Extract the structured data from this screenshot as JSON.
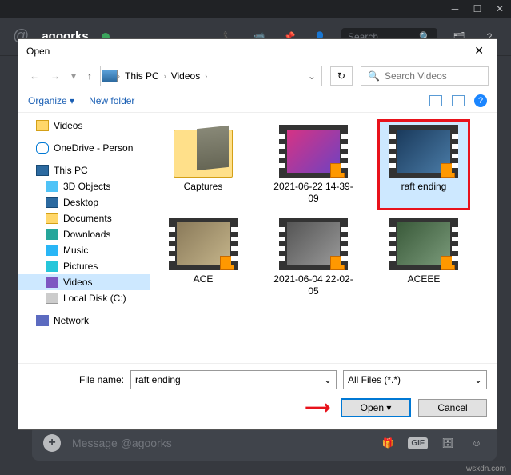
{
  "discord": {
    "username": "agoorks",
    "search_placeholder": "Search",
    "msg_placeholder": "Message @agoorks",
    "gif_label": "GIF"
  },
  "dialog": {
    "title": "Open",
    "breadcrumb": {
      "root": "This PC",
      "folder": "Videos"
    },
    "search_placeholder": "Search Videos",
    "toolbar": {
      "organize": "Organize",
      "newfolder": "New folder"
    },
    "tree": [
      {
        "label": "Videos",
        "icon": "ic-folder",
        "level": 1
      },
      {
        "label": "OneDrive - Person",
        "icon": "ic-cloud",
        "level": 1,
        "gap": true
      },
      {
        "label": "This PC",
        "icon": "ic-monitor",
        "level": 1,
        "gap": true
      },
      {
        "label": "3D Objects",
        "icon": "ic-3d",
        "level": 2
      },
      {
        "label": "Desktop",
        "icon": "ic-monitor",
        "level": 2
      },
      {
        "label": "Documents",
        "icon": "ic-folder",
        "level": 2
      },
      {
        "label": "Downloads",
        "icon": "ic-down",
        "level": 2
      },
      {
        "label": "Music",
        "icon": "ic-music",
        "level": 2
      },
      {
        "label": "Pictures",
        "icon": "ic-pic",
        "level": 2
      },
      {
        "label": "Videos",
        "icon": "ic-video",
        "level": 2,
        "selected": true
      },
      {
        "label": "Local Disk (C:)",
        "icon": "ic-drive",
        "level": 2
      },
      {
        "label": "Network",
        "icon": "ic-net",
        "level": 1,
        "gap": true
      }
    ],
    "files": [
      {
        "name": "Captures",
        "type": "folder"
      },
      {
        "name": "2021-06-22 14-39-09",
        "type": "video",
        "thumb": "t2"
      },
      {
        "name": "raft ending",
        "type": "video",
        "thumb": "t3",
        "selected": true
      },
      {
        "name": "ACE",
        "type": "video",
        "thumb": "t4"
      },
      {
        "name": "2021-06-04 22-02-05",
        "type": "video",
        "thumb": "t5"
      },
      {
        "name": "ACEEE",
        "type": "video",
        "thumb": "t6"
      }
    ],
    "footer": {
      "filename_label": "File name:",
      "filename_value": "raft ending",
      "filter": "All Files (*.*)",
      "open": "Open",
      "cancel": "Cancel"
    }
  },
  "watermark": "wsxdn.com"
}
